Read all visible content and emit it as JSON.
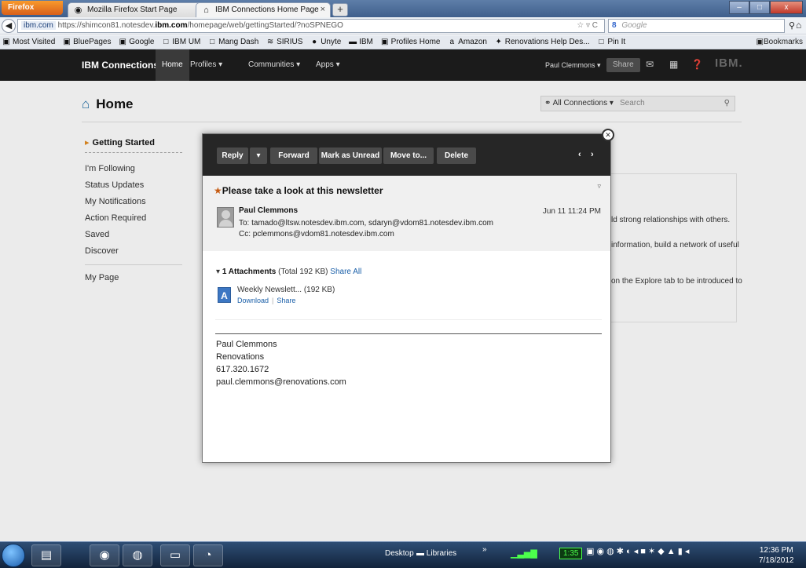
{
  "browser": {
    "menu_button": "Firefox",
    "tabs": [
      {
        "title": "Mozilla Firefox Start Page",
        "icon": "firefox-icon",
        "close": "×"
      },
      {
        "title": "IBM Connections Home Page",
        "icon": "home-icon",
        "close": "×"
      }
    ],
    "new_tab": "+",
    "window_controls": {
      "minimize": "–",
      "maximize": "□",
      "close": "x"
    },
    "url": {
      "site_badge": "ibm.com",
      "prefix": "https://shimcon81.notesdev.",
      "host": "ibm.com",
      "path": "/homepage/web/gettingStarted/?noSPNEGO",
      "controls": "☆ ▿ C"
    },
    "search": {
      "engine": "8",
      "placeholder": "Google"
    },
    "bookmarks": [
      "Most Visited",
      "BluePages",
      "Google",
      "IBM UM",
      "Mang Dash",
      "SIRIUS",
      "Unyte",
      "IBM",
      "Profiles Home",
      "Amazon",
      "Renovations Help Des...",
      "Pin It"
    ],
    "bookmarks_menu": "Bookmarks"
  },
  "ibm_nav": {
    "brand": "IBM Connections",
    "items": [
      "Home",
      "Profiles ▾",
      "Communities ▾",
      "Apps ▾"
    ],
    "user": "Paul Clemmons ▾",
    "share": "Share",
    "logo": "IBM."
  },
  "page": {
    "title": "Home",
    "scope": "All Connections",
    "scope_caret": "▾",
    "search_placeholder": "Search",
    "sidebar": {
      "active": "Getting Started",
      "items": [
        "I'm Following",
        "Status Updates",
        "My Notifications",
        "Action Required",
        "Saved",
        "Discover"
      ],
      "bottom": "My Page"
    },
    "background_text": [
      "ld strong relationships with others.",
      "information, build a network of useful",
      "on the Explore tab to be introduced to"
    ]
  },
  "message": {
    "toolbar": {
      "reply": "Reply",
      "reply_menu": "▾",
      "forward": "Forward",
      "mark_unread": "Mark as Unread",
      "move": "Move to...",
      "delete": "Delete",
      "prev": "‹",
      "next": "›"
    },
    "close": "✕",
    "subject": "Please take a look at this newsletter",
    "star": "★",
    "toggle": "▿",
    "sender": "Paul Clemmons",
    "date": "Jun 11 11:24 PM",
    "to": "To: tamado@ltsw.notesdev.ibm.com, sdaryn@vdom81.notesdev.ibm.com",
    "cc": "Cc: pclemmons@vdom81.notesdev.ibm.com",
    "attachments": {
      "toggle": "▾",
      "count": "1 Attachments",
      "total": "(Total 192 KB)",
      "share_all": "Share All",
      "file": {
        "name": "Weekly Newslett...",
        "size": "(192 KB)",
        "download": "Download",
        "share": "Share"
      }
    },
    "signature": [
      "Paul Clemmons",
      "Renovations",
      "617.320.1672",
      "paul.clemmons@renovations.com"
    ]
  },
  "taskbar": {
    "desktop": "Desktop",
    "libraries": "Libraries",
    "overflow": "»",
    "battery": "1:35",
    "time": "12:36 PM",
    "date": "7/18/2012"
  }
}
